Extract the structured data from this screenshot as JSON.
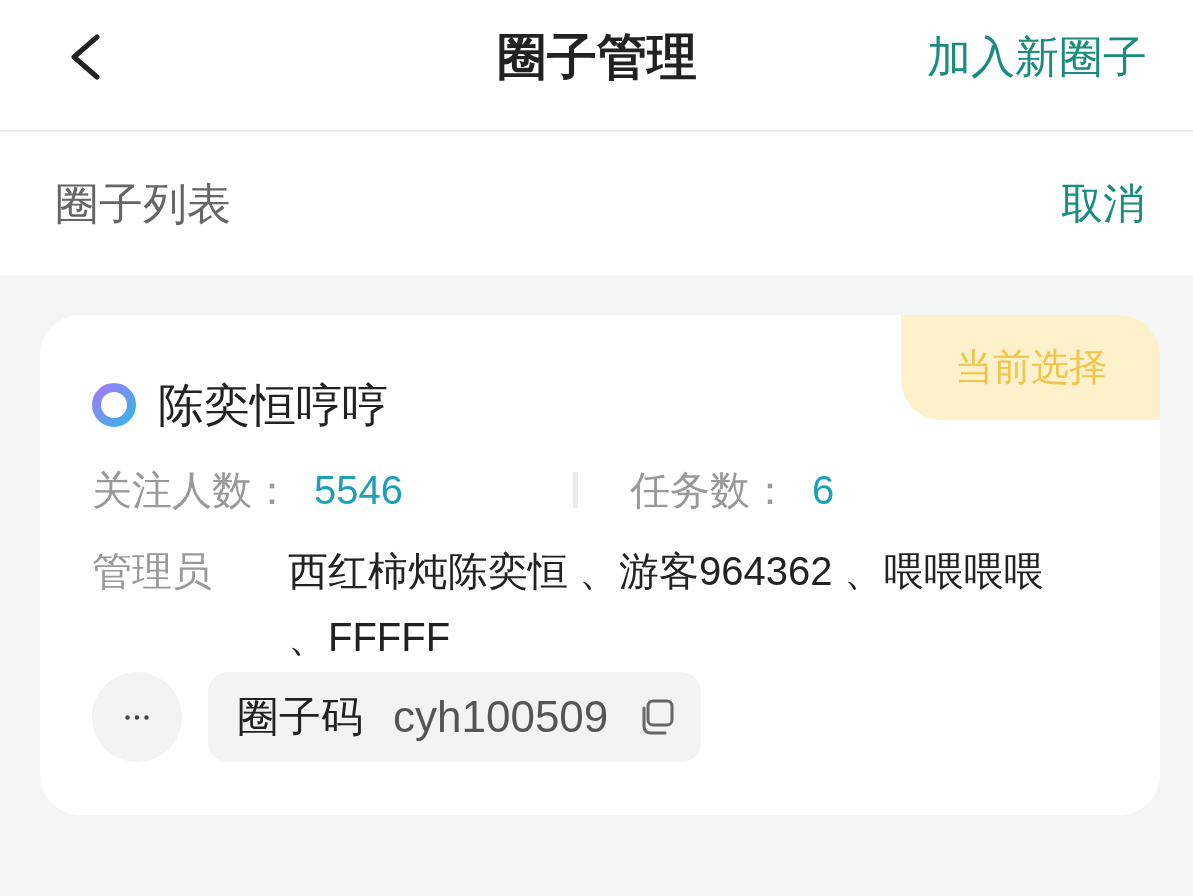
{
  "header": {
    "title": "圈子管理",
    "action": "加入新圈子"
  },
  "list_header": {
    "title": "圈子列表",
    "action": "取消"
  },
  "circles": [
    {
      "name": "陈奕恒哼哼",
      "selected": true,
      "badge": "当前选择",
      "stats": [
        {
          "label": "关注人数：",
          "value": "5546"
        },
        {
          "label": "任务数：",
          "value": "6"
        }
      ],
      "admins_label": "管理员",
      "admins": "西红柿炖陈奕恒 、游客964362 、喂喂喂喂、FFFFF",
      "code_label": "圈子码",
      "code": "cyh100509"
    }
  ]
}
